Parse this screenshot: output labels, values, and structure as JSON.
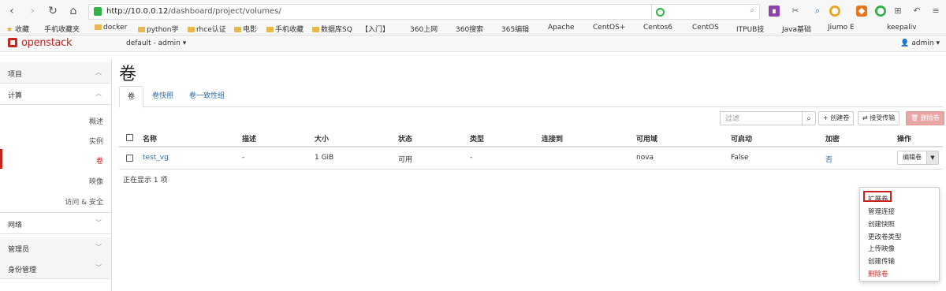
{
  "browser": {
    "url_host": "http://10.0.0.12",
    "url_path": "/dashboard/project/volumes/",
    "bookmarks": [
      "收藏",
      "手机收藏夹",
      "docker",
      "python学",
      "rhce认证",
      "电影",
      "手机收藏",
      "数据库SQ",
      "【入门】",
      "360上网",
      "360搜索",
      "365编辑",
      "Apache",
      "CentOS+",
      "Centos6",
      "CentOS",
      "ITPUB技",
      "Java基础",
      "Jiumo E",
      "keepaliv"
    ]
  },
  "topnav": {
    "brand": "openstack",
    "project_switch": "default - admin ▾",
    "user": "admin ▾"
  },
  "sidebar": {
    "project": "项目",
    "compute": "计算",
    "items": [
      "概述",
      "实例",
      "卷",
      "映像",
      "访问 & 安全"
    ],
    "network": "网络",
    "admin": "管理员",
    "identity": "身份管理"
  },
  "page": {
    "title": "卷",
    "tabs": [
      "卷",
      "卷快照",
      "卷一致性组"
    ]
  },
  "toolbar": {
    "filter_placeholder": "过滤",
    "create": "+ 创建卷",
    "accept_transfer": "⇄ 接受传输",
    "delete": "🗑 删除卷"
  },
  "table": {
    "headers": [
      "名称",
      "描述",
      "大小",
      "状态",
      "类型",
      "连接到",
      "可用域",
      "可启动",
      "加密",
      "操作"
    ],
    "rows": [
      {
        "name": "test_vg",
        "desc": "-",
        "size": "1 GiB",
        "status": "可用",
        "type": "-",
        "attached": "",
        "zone": "nova",
        "bootable": "False",
        "encrypted": "否",
        "action": "编辑卷"
      }
    ],
    "footer": "正在显示 1 项"
  },
  "dropdown": {
    "items": [
      "扩展卷",
      "管理连接",
      "创建快照",
      "更改卷类型",
      "上传映像",
      "创建传输",
      "删除卷"
    ]
  },
  "colors": {
    "brand_red": "#c9211e",
    "link_blue": "#2e6da4",
    "danger_button": "#e8a6a5"
  }
}
